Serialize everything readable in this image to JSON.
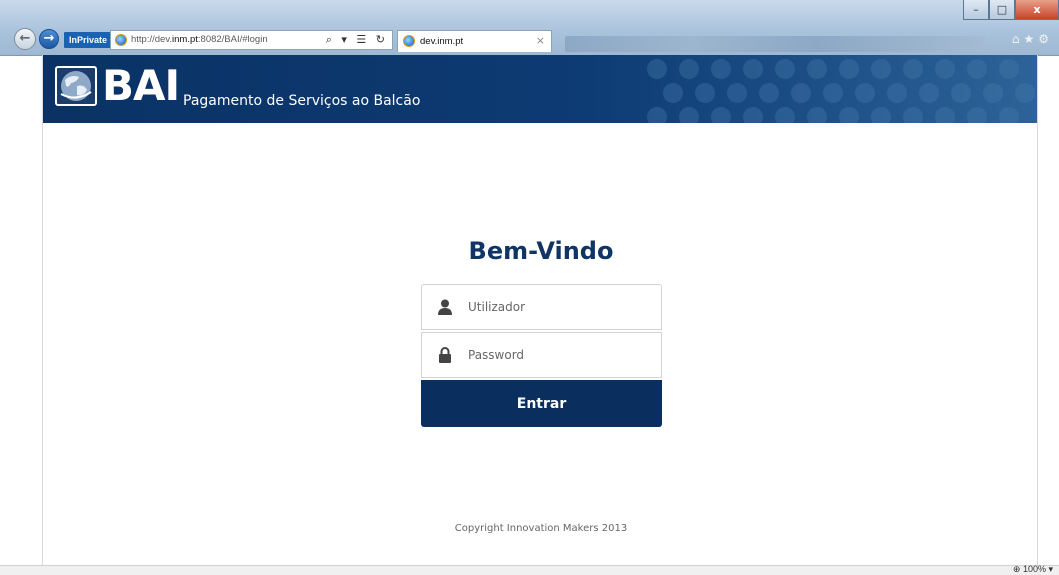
{
  "browser": {
    "inprivate_label": "InPrivate",
    "url_prefix": "http://dev.",
    "url_domain": "inm.pt",
    "url_suffix": ":8082/BAI/#login",
    "address_tools": "⌕ ▾ ☰ ↻",
    "tab_title": "dev.inm.pt",
    "tab_close": "×",
    "right_tools": "⌂★⚙",
    "window_controls": {
      "minimize": "–",
      "maximize": "□",
      "close": "x"
    },
    "zoom": "⊕ 100%  ▾"
  },
  "header": {
    "logo_text": "BAI",
    "subtitle": "Pagamento de Serviços ao Balcão",
    "colors": {
      "primary": "#0a3265",
      "accent": "#2d6398"
    }
  },
  "login": {
    "title": "Bem-Vindo",
    "username_placeholder": "Utilizador",
    "username_icon": "user-icon",
    "password_placeholder": "Password",
    "password_icon": "lock-icon",
    "submit_label": "Entrar",
    "button_color": "#0a2f5e"
  },
  "footer": {
    "copyright": "Copyright Innovation Makers 2013"
  }
}
